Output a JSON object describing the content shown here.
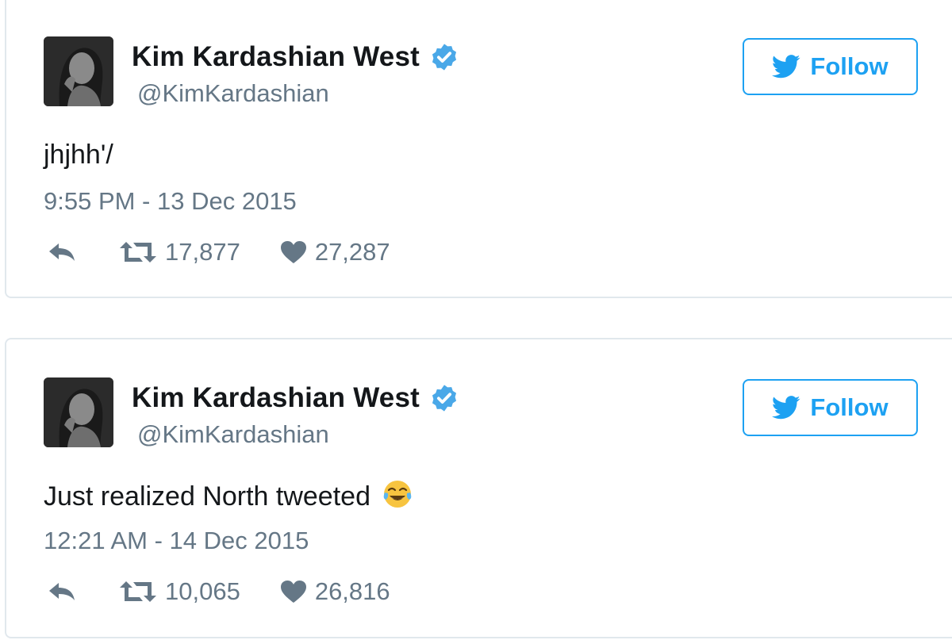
{
  "colors": {
    "twitter_blue": "#1da1f2",
    "verified_blue": "#4aa8e8",
    "text_dark": "#14171a",
    "text_gray": "#657786",
    "border": "#e1e8ed"
  },
  "tweets": [
    {
      "name": "Kim Kardashian West",
      "handle": "@KimKardashian",
      "follow_label": "Follow",
      "text": "jhjhh'/",
      "timestamp": "9:55 PM - 13 Dec 2015",
      "retweets": "17,877",
      "likes": "27,287",
      "icons": [
        "avatar",
        "verified-badge-icon",
        "twitter-bird-icon",
        "reply-icon",
        "retweet-icon",
        "heart-icon"
      ]
    },
    {
      "name": "Kim Kardashian West",
      "handle": "@KimKardashian",
      "follow_label": "Follow",
      "text": "Just realized North tweeted",
      "emoji": "face-with-tears-of-joy",
      "timestamp": "12:21 AM - 14 Dec 2015",
      "retweets": "10,065",
      "likes": "26,816",
      "icons": [
        "avatar",
        "verified-badge-icon",
        "twitter-bird-icon",
        "reply-icon",
        "retweet-icon",
        "heart-icon",
        "tears-of-joy-emoji-icon"
      ]
    }
  ]
}
